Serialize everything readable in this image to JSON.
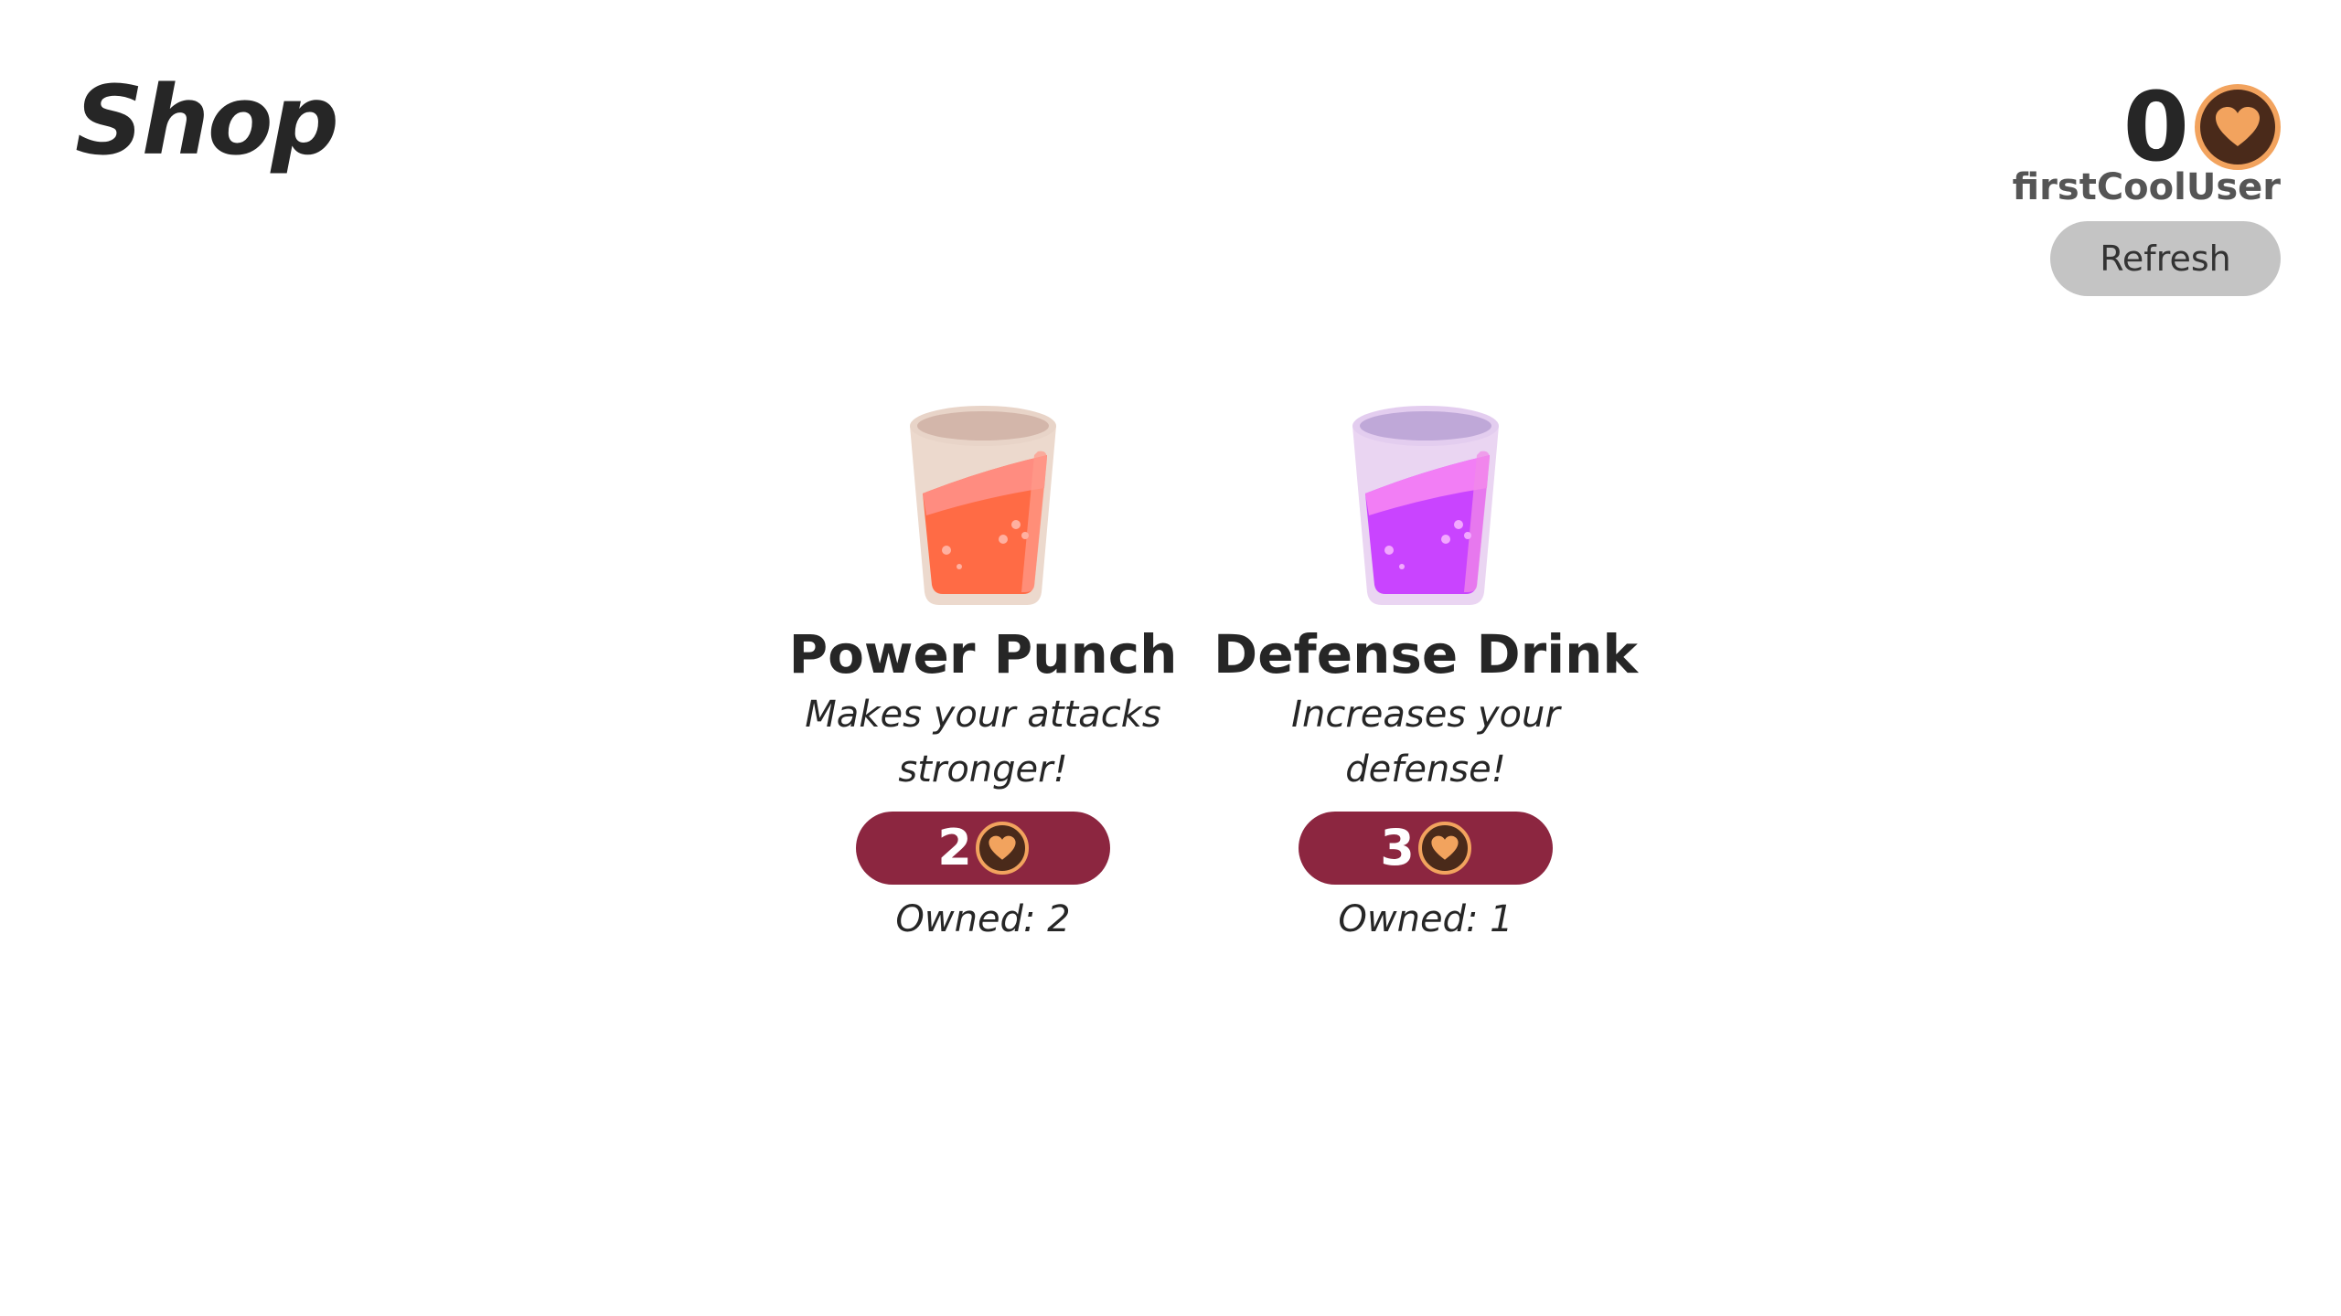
{
  "header": {
    "title": "Shop"
  },
  "user": {
    "balance": "0",
    "username": "firstCoolUser",
    "refresh_label": "Refresh"
  },
  "items": [
    {
      "name": "Power Punch",
      "description": "Makes your attacks stronger!",
      "price": "2",
      "owned_label": "Owned: 2",
      "icon": "red-drink-cup-icon",
      "drink_color": "#ff6b45"
    },
    {
      "name": "Defense Drink",
      "description": "Increases your defense!",
      "price": "3",
      "owned_label": "Owned: 1",
      "icon": "purple-drink-cup-icon",
      "drink_color": "#c944ff"
    }
  ],
  "colors": {
    "price_button": "#8c2640",
    "coin_ring": "#f2a35e",
    "coin_fill": "#4a2a1a",
    "refresh_button": "#c4c4c4"
  },
  "icons": {
    "currency": "heart-coin-icon"
  }
}
